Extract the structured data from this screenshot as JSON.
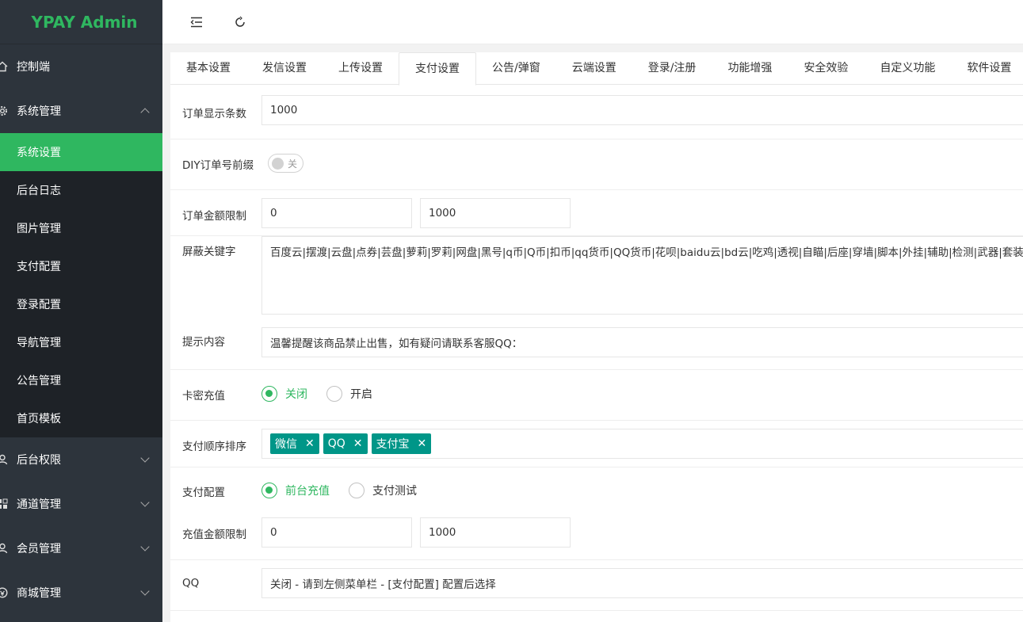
{
  "app": {
    "title": "YPAY Admin"
  },
  "sidebar": {
    "dashboard": {
      "label": "控制端",
      "icon": "home-icon"
    },
    "system": {
      "label": "系统管理",
      "icon": "gear-icon"
    },
    "sub_items": [
      {
        "label": "系统设置",
        "active": true
      },
      {
        "label": "后台日志"
      },
      {
        "label": "图片管理"
      },
      {
        "label": "支付配置"
      },
      {
        "label": "登录配置"
      },
      {
        "label": "导航管理"
      },
      {
        "label": "公告管理"
      },
      {
        "label": "首页模板"
      }
    ],
    "groups": [
      {
        "label": "后台权限",
        "icon": "user-icon"
      },
      {
        "label": "通道管理",
        "icon": "apps-icon"
      },
      {
        "label": "会员管理",
        "icon": "user-icon"
      },
      {
        "label": "商城管理",
        "icon": "shop-icon"
      }
    ]
  },
  "header": {
    "menu_icon": "menu-fold-icon",
    "refresh_icon": "refresh-icon"
  },
  "tabs": [
    {
      "label": "基本设置"
    },
    {
      "label": "发信设置"
    },
    {
      "label": "上传设置"
    },
    {
      "label": "支付设置",
      "active": true
    },
    {
      "label": "公告/弹窗"
    },
    {
      "label": "云端设置"
    },
    {
      "label": "登录/注册"
    },
    {
      "label": "功能增强"
    },
    {
      "label": "安全效验"
    },
    {
      "label": "自定义功能"
    },
    {
      "label": "软件设置"
    }
  ],
  "form": {
    "order_display_count": {
      "label": "订单显示条数",
      "value": "1000"
    },
    "diy_order_prefix": {
      "label": "DIY订单号前缀",
      "switch_text": "关"
    },
    "order_amount_limit": {
      "label": "订单金额限制",
      "min": "0",
      "max": "1000"
    },
    "blocked_keywords": {
      "label": "屏蔽关键字",
      "value": "百度云|摆渡|云盘|点券|芸盘|萝莉|罗莉|网盘|黑号|q币|Q币|扣币|qq货币|QQ货币|花呗|baidu云|bd云|吃鸡|透视|自瞄|后座|穿墙|脚本|外挂|辅助|检测|武器|套装"
    },
    "tip_content": {
      "label": "提示内容",
      "value": "温馨提醒该商品禁止出售，如有疑问请联系客服QQ："
    },
    "card_recharge": {
      "label": "卡密充值",
      "options": [
        "关闭",
        "开启"
      ],
      "selected": "关闭"
    },
    "payment_order": {
      "label": "支付顺序排序",
      "tags": [
        "微信",
        "QQ",
        "支付宝"
      ]
    },
    "payment_config": {
      "label": "支付配置",
      "options": [
        "前台充值",
        "支付测试"
      ],
      "selected": "前台充值"
    },
    "recharge_amount_limit": {
      "label": "充值金额限制",
      "min": "0",
      "max": "1000"
    },
    "qq": {
      "label": "QQ",
      "value": "关闭 - 请到左侧菜单栏 - [支付配置] 配置后选择"
    }
  },
  "colors": {
    "accent": "#2fb760",
    "sidebar_bg": "#2d343c",
    "tag_bg": "#009688"
  }
}
